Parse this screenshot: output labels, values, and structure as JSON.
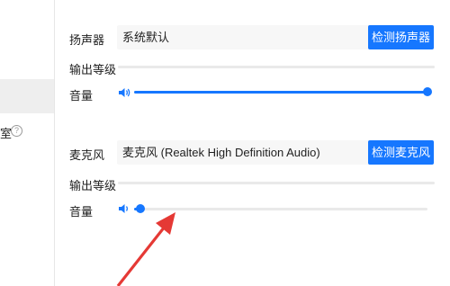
{
  "sidebar": {
    "partial_text": "室",
    "help_symbol": "?"
  },
  "speaker": {
    "label": "扬声器",
    "select_value": "系统默认",
    "test_button": "检测扬声器",
    "output_level_label": "输出等级",
    "volume_label": "音量",
    "volume_level": 1.0
  },
  "microphone": {
    "label": "麦克风",
    "select_value": "麦克风 (Realtek High Definition Audio)",
    "test_button": "检测麦克风",
    "output_level_label": "输出等级",
    "volume_label": "音量",
    "volume_level": 0.02
  },
  "colors": {
    "accent": "#1677ff",
    "annotation_arrow": "#e53935"
  }
}
